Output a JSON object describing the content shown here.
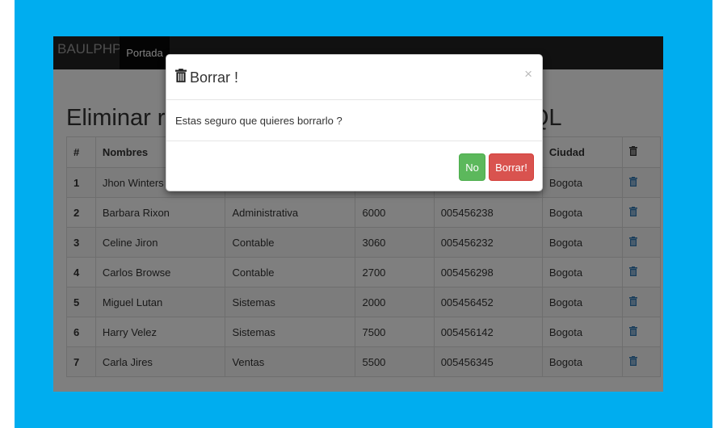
{
  "navbar": {
    "brand": "BAULPHP",
    "links": [
      "Portada"
    ]
  },
  "page": {
    "heading": "Eliminar registros con Bootstrap, PHP y MySQL"
  },
  "table": {
    "headers": [
      "#",
      "Nombres",
      "",
      "",
      "",
      "Ciudad",
      "trash-icon"
    ],
    "rows": [
      [
        "1",
        "Jhon Winters",
        "",
        "",
        "",
        "Bogota"
      ],
      [
        "2",
        "Barbara Rixon",
        "Administrativa",
        "6000",
        "005456238",
        "Bogota"
      ],
      [
        "3",
        "Celine Jiron",
        "Contable",
        "3060",
        "005456232",
        "Bogota"
      ],
      [
        "4",
        "Carlos Browse",
        "Contable",
        "2700",
        "005456298",
        "Bogota"
      ],
      [
        "5",
        "Miguel Lutan",
        "Sistemas",
        "2000",
        "005456452",
        "Bogota"
      ],
      [
        "6",
        "Harry Velez",
        "Sistemas",
        "7500",
        "005456142",
        "Bogota"
      ],
      [
        "7",
        "Carla Jires",
        "Ventas",
        "5500",
        "005456345",
        "Bogota"
      ]
    ]
  },
  "modal": {
    "title": "Borrar !",
    "close": "×",
    "body": "Estas seguro que quieres borrarlo ?",
    "no_label": "No",
    "delete_label": "Borrar!"
  },
  "colors": {
    "frame": "#00adef",
    "danger": "#d9534f",
    "success": "#5cb85c",
    "icon": "#337ab7"
  }
}
